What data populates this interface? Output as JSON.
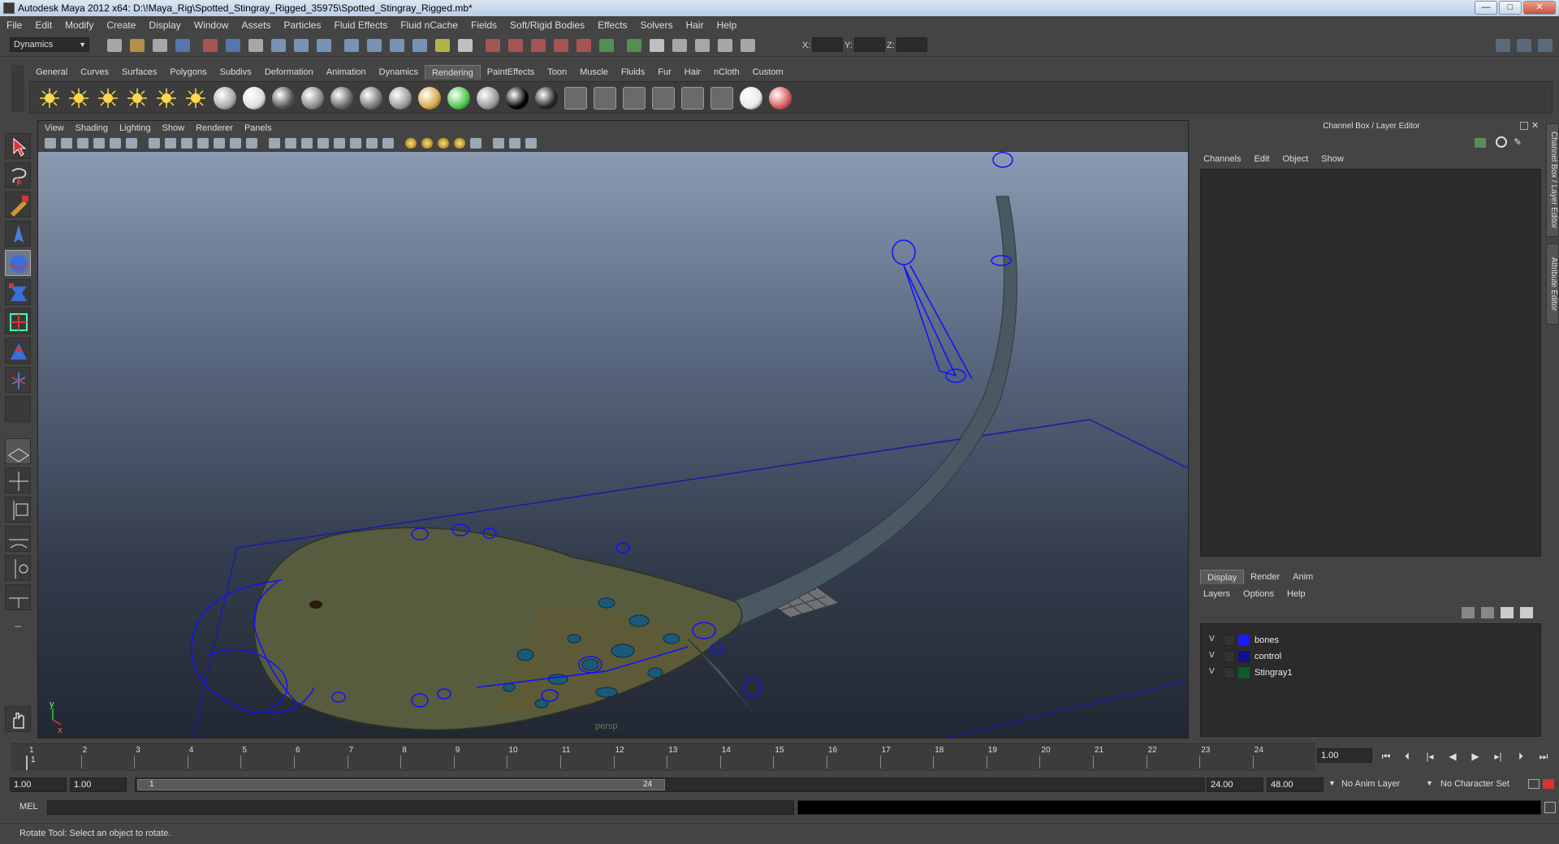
{
  "window": {
    "title": "Autodesk Maya 2012 x64: D:\\!Maya_Rig\\Spotted_Stingray_Rigged_35975\\Spotted_Stingray_Rigged.mb*",
    "minimize": "—",
    "maximize": "□",
    "close": "✕"
  },
  "menubar": [
    "File",
    "Edit",
    "Modify",
    "Create",
    "Display",
    "Window",
    "Assets",
    "Particles",
    "Fluid Effects",
    "Fluid nCache",
    "Fields",
    "Soft/Rigid Bodies",
    "Effects",
    "Solvers",
    "Hair",
    "Help"
  ],
  "statusline": {
    "menuset": "Dynamics",
    "x_label": "X:",
    "y_label": "Y:",
    "z_label": "Z:"
  },
  "shelf": {
    "tabs": [
      "General",
      "Curves",
      "Surfaces",
      "Polygons",
      "Subdivs",
      "Deformation",
      "Animation",
      "Dynamics",
      "Rendering",
      "PaintEffects",
      "Toon",
      "Muscle",
      "Fluids",
      "Fur",
      "Hair",
      "nCloth",
      "Custom"
    ],
    "active_tab": "Rendering"
  },
  "viewport": {
    "menus": [
      "View",
      "Shading",
      "Lighting",
      "Show",
      "Renderer",
      "Panels"
    ],
    "camera_label": "persp",
    "axis_y": "y",
    "axis_x": "x"
  },
  "channel_box": {
    "title": "Channel Box / Layer Editor",
    "menus": [
      "Channels",
      "Edit",
      "Object",
      "Show"
    ],
    "side_tabs": [
      "Channel Box / Layer Editor",
      "Attribute Editor"
    ]
  },
  "layer_editor": {
    "tabs": [
      "Display",
      "Render",
      "Anim"
    ],
    "active_tab": "Display",
    "menus": [
      "Layers",
      "Options",
      "Help"
    ],
    "layers": [
      {
        "visible": "V",
        "name": "bones",
        "color": "#1a1aff"
      },
      {
        "visible": "V",
        "name": "control",
        "color": "#10108a"
      },
      {
        "visible": "V",
        "name": "Stingray1",
        "color": "#0d5a2a"
      }
    ]
  },
  "time_slider": {
    "frames": [
      "1",
      "2",
      "3",
      "4",
      "5",
      "6",
      "7",
      "8",
      "9",
      "10",
      "11",
      "12",
      "13",
      "14",
      "15",
      "16",
      "17",
      "18",
      "19",
      "20",
      "21",
      "22",
      "23",
      "24"
    ],
    "current_frame_marker": "1",
    "current_frame": "1.00"
  },
  "range_slider": {
    "start_time": "1.00",
    "playback_start": "1.00",
    "range_start_label": "1",
    "range_end_label": "24",
    "playback_end": "24.00",
    "end_time": "48.00",
    "anim_layer": "No Anim Layer",
    "character_set": "No Character Set"
  },
  "command_line": {
    "label": "MEL"
  },
  "help_line": {
    "text": "Rotate Tool: Select an object to rotate."
  }
}
